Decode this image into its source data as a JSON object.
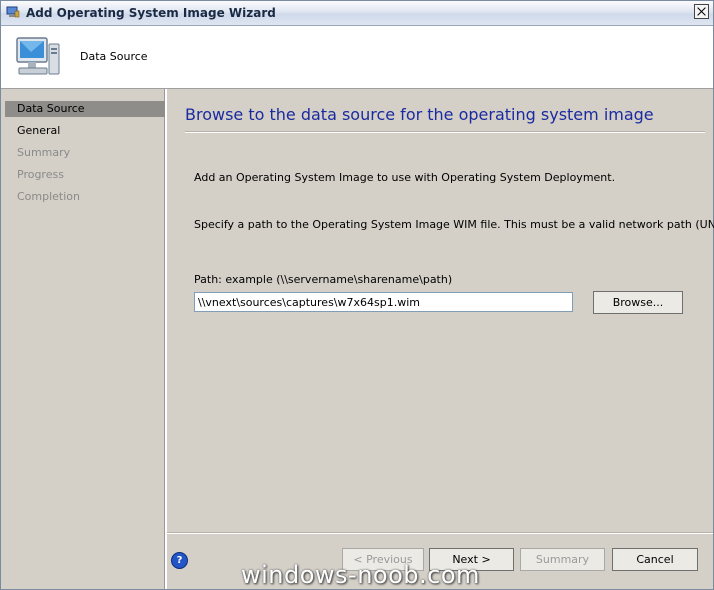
{
  "window": {
    "title": "Add Operating System Image Wizard"
  },
  "header": {
    "title": "Data Source",
    "icon": "computer-icon"
  },
  "sidebar": {
    "items": [
      {
        "label": "Data Source",
        "state": "active"
      },
      {
        "label": "General",
        "state": "normal"
      },
      {
        "label": "Summary",
        "state": "disabled"
      },
      {
        "label": "Progress",
        "state": "disabled"
      },
      {
        "label": "Completion",
        "state": "disabled"
      }
    ]
  },
  "main": {
    "heading": "Browse to the data source for the operating system image",
    "description": "Add an Operating System Image to use with Operating System Deployment.",
    "instruction": "Specify a path to the Operating System Image WIM file. This must be a valid network path (UNC).",
    "path_label": "Path: example (\\\\servername\\sharename\\path)",
    "path_value": "\\\\vnext\\sources\\captures\\w7x64sp1.wim",
    "browse_label": "Browse..."
  },
  "footer": {
    "previous_label": "< Previous",
    "next_label": "Next >",
    "summary_label": "Summary",
    "cancel_label": "Cancel",
    "help_icon": "help-icon"
  },
  "watermark": "windows-noob.com",
  "colors": {
    "heading": "#1a2aa0",
    "active_step": "#8e8d89",
    "dialog_bg": "#d4d0c8"
  }
}
